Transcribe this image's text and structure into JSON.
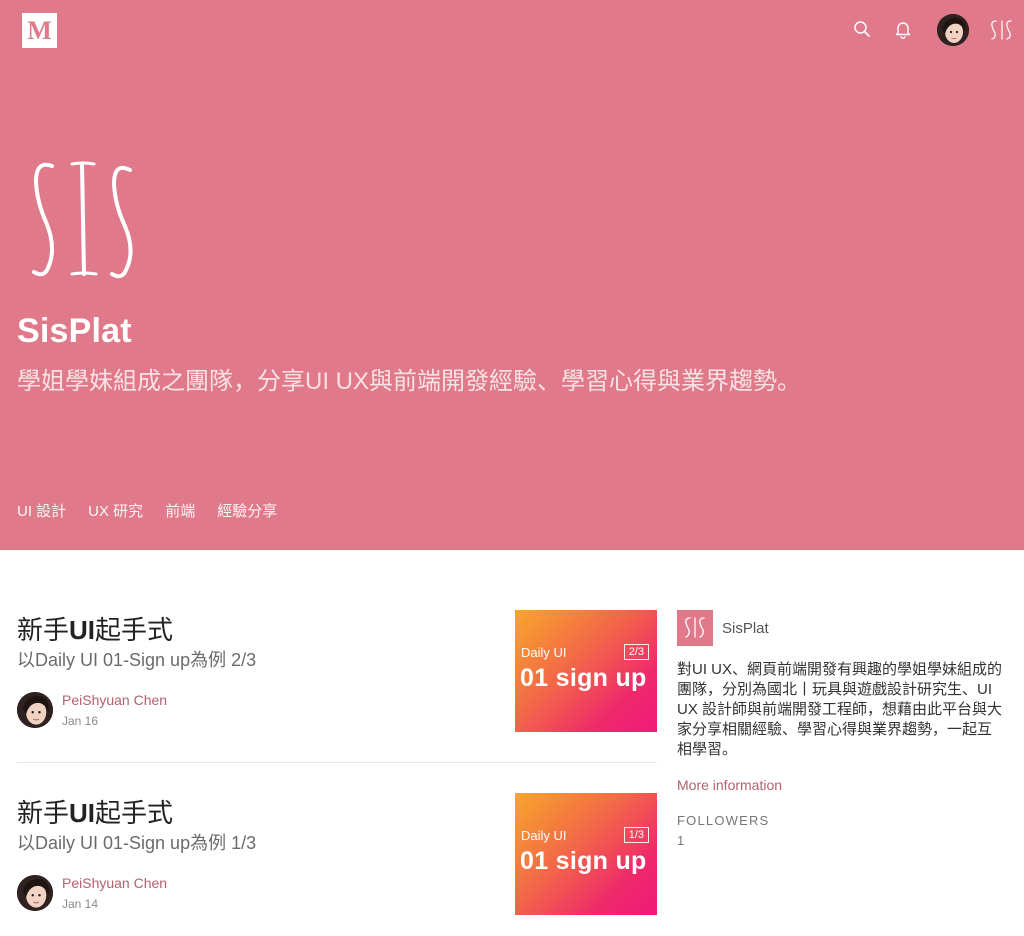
{
  "topbar": {
    "logo_letter": "M",
    "icons": [
      "search-icon",
      "bell-icon",
      "avatar",
      "sis-logo-icon"
    ]
  },
  "publication": {
    "logo_text": "SIS",
    "title": "SisPlat",
    "tagline": "學姐學妹組成之團隊，分享UI UX與前端開發經驗、學習心得與業界趨勢。",
    "nav": [
      "UI 設計",
      "UX 研究",
      "前端",
      "經驗分享"
    ]
  },
  "posts": [
    {
      "title_cjk_1": "新手",
      "title_latin": "UI",
      "title_cjk_2": "起手式",
      "subtitle": "以Daily UI 01-Sign up為例 2/3",
      "author": "PeiShyuan Chen",
      "date": "Jan 16",
      "thumb_label": "Daily UI",
      "thumb_page": "2/3",
      "thumb_main": "01 sign up"
    },
    {
      "title_cjk_1": "新手",
      "title_latin": "UI",
      "title_cjk_2": "起手式",
      "subtitle": "以Daily UI 01-Sign up為例 1/3",
      "author": "PeiShyuan Chen",
      "date": "Jan 14",
      "thumb_label": "Daily UI",
      "thumb_page": "1/3",
      "thumb_main": "01 sign up"
    }
  ],
  "sidebar": {
    "name": "SisPlat",
    "description": "對UI UX、網頁前端開發有興趣的學姐學妹組成的團隊，分別為國北丨玩具與遊戲設計研究生、UI UX 設計師與前端開發工程師，想藉由此平台與大家分享相關經驗、學習心得與業界趨勢，一起互相學習。",
    "more_info": "More information",
    "followers_label": "FOLLOWERS",
    "followers_count": "1"
  },
  "colors": {
    "brand_pink": "#e07a8a",
    "link_rose": "#b2616d",
    "thumb_gradient_start": "#f7a72a",
    "thumb_gradient_end": "#ee1a78"
  }
}
